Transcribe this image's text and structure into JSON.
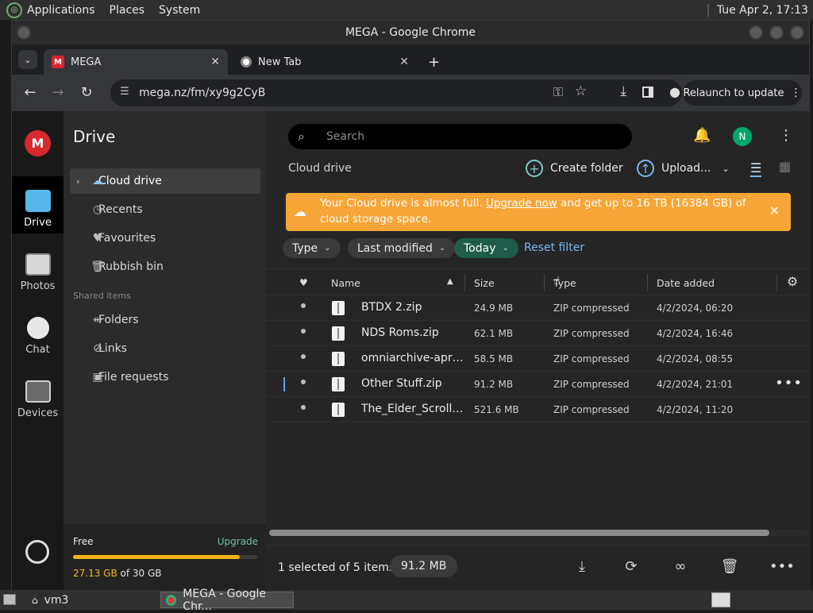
{
  "os_panel": {
    "menus": [
      "Applications",
      "Places",
      "System"
    ],
    "clock": "Tue Apr  2, 17:13"
  },
  "window": {
    "title": "MEGA - Google Chrome"
  },
  "tabs": [
    {
      "label": "MEGA",
      "favicon": "M"
    },
    {
      "label": "New Tab"
    }
  ],
  "toolbar": {
    "url": "mega.nz/fm/xy9g2CyB",
    "relaunch_label": "Relaunch to update"
  },
  "rail": {
    "logo": "M",
    "items": [
      {
        "label": "Drive"
      },
      {
        "label": "Photos"
      },
      {
        "label": "Chat"
      },
      {
        "label": "Devices"
      }
    ]
  },
  "sidebar": {
    "title": "Drive",
    "items": [
      {
        "label": "Cloud drive"
      },
      {
        "label": "Recents"
      },
      {
        "label": "Favourites"
      },
      {
        "label": "Rubbish bin"
      }
    ],
    "shared_label": "Shared items",
    "shared_items": [
      {
        "label": "Folders"
      },
      {
        "label": "Links"
      },
      {
        "label": "File requests"
      }
    ],
    "storage": {
      "free_label": "Free",
      "upgrade_label": "Upgrade",
      "used": "27.13 GB",
      "total": " of 30 GB",
      "fraction": 0.904
    }
  },
  "main": {
    "search_placeholder": "Search",
    "avatar_initial": "N",
    "breadcrumb": "Cloud drive",
    "create_folder": "Create folder",
    "upload": "Upload...",
    "banner": {
      "text_before": "Your Cloud drive is almost full. ",
      "link": "Upgrade now",
      "text_after": " and get up to 16 TB (16384 GB) of cloud storage space."
    },
    "filters": {
      "type": "Type",
      "last_modified": "Last modified",
      "today": "Today",
      "reset": "Reset filter"
    },
    "columns": {
      "name": "Name",
      "size": "Size",
      "type": "Type",
      "date": "Date added"
    },
    "files": [
      {
        "name": "BTDX 2.zip",
        "size": "24.9 MB",
        "type": "ZIP compressed",
        "date": "4/2/2024, 06:20"
      },
      {
        "name": "NDS Roms.zip",
        "size": "62.1 MB",
        "type": "ZIP compressed",
        "date": "4/2/2024, 16:46"
      },
      {
        "name": "omniarchive-april-...",
        "size": "58.5 MB",
        "type": "ZIP compressed",
        "date": "4/2/2024, 08:55"
      },
      {
        "name": "Other Stuff.zip",
        "size": "91.2 MB",
        "type": "ZIP compressed",
        "date": "4/2/2024, 21:01"
      },
      {
        "name": "The_Elder_Scrolls...",
        "size": "521.6 MB",
        "type": "ZIP compressed",
        "date": "4/2/2024, 11:20"
      }
    ],
    "footer": {
      "selected_count": "1 selected of 5 items",
      "selected_size": "91.2 MB"
    }
  },
  "taskbar": {
    "items": [
      {
        "label": "vm3"
      },
      {
        "label": "MEGA - Google Chr..."
      }
    ]
  },
  "colors": {
    "accent_red": "#d9272e",
    "warning": "#f7a536",
    "storage_fill": "#f2b41c",
    "link": "#79b7f0"
  }
}
